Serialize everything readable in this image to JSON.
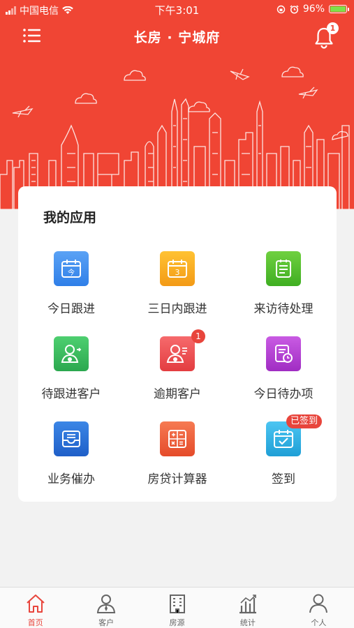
{
  "status_bar": {
    "carrier": "中国电信",
    "time": "下午3:01",
    "battery": "96%"
  },
  "header": {
    "title": "长房 · 宁城府",
    "notification_count": "1"
  },
  "apps": {
    "title": "我的应用",
    "items": [
      {
        "label": "今日跟进",
        "icon": "calendar-today-icon",
        "icon_text": "今",
        "color": "#3f8ff0"
      },
      {
        "label": "三日内跟进",
        "icon": "calendar-3-icon",
        "icon_text": "3",
        "color": "#f7a823"
      },
      {
        "label": "来访待处理",
        "icon": "clipboard-icon",
        "color": "#56c12d"
      },
      {
        "label": "待跟进客户",
        "icon": "customer-follow-icon",
        "color": "#3fbf63"
      },
      {
        "label": "逾期客户",
        "icon": "overdue-customer-icon",
        "color": "#ef5356",
        "badge": "1"
      },
      {
        "label": "今日待办项",
        "icon": "todo-clock-icon",
        "color": "#b53ed3"
      },
      {
        "label": "业务催办",
        "icon": "inbox-icon",
        "color": "#2a6fd6"
      },
      {
        "label": "房贷计算器",
        "icon": "calculator-icon",
        "color": "#f0613b"
      },
      {
        "label": "签到",
        "icon": "checkin-icon",
        "color": "#33b4e8",
        "tag": "已签到"
      }
    ]
  },
  "tabbar": {
    "items": [
      {
        "label": "首页",
        "icon": "home-icon",
        "active": true
      },
      {
        "label": "客户",
        "icon": "customer-icon"
      },
      {
        "label": "房源",
        "icon": "building-icon"
      },
      {
        "label": "统计",
        "icon": "chart-icon"
      },
      {
        "label": "个人",
        "icon": "person-icon"
      }
    ]
  },
  "colors": {
    "brand": "#f04534",
    "background": "#f2f2f2",
    "badge": "#e8453c"
  }
}
